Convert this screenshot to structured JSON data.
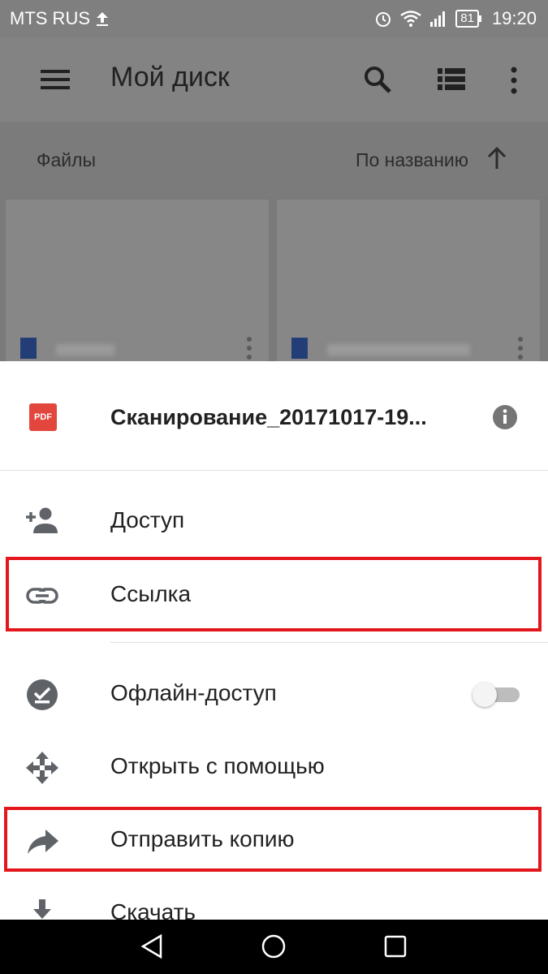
{
  "status_bar": {
    "carrier": "MTS RUS",
    "battery": "81",
    "time": "19:20"
  },
  "app_bar": {
    "title": "Мой диск",
    "icons": [
      "menu-icon",
      "search-icon",
      "list-view-icon",
      "more-vert-icon"
    ]
  },
  "sort_bar": {
    "section": "Файлы",
    "sort_label": "По названию"
  },
  "sheet": {
    "file_icon_label": "PDF",
    "file_name": "Сканирование_20171017-19...",
    "items": [
      {
        "label": "Доступ",
        "icon": "person-add-icon"
      },
      {
        "label": "Ссылка",
        "icon": "link-icon"
      },
      {
        "label": "Офлайн-доступ",
        "icon": "offline-check-icon",
        "toggle": false
      },
      {
        "label": "Открыть с помощью",
        "icon": "open-with-icon"
      },
      {
        "label": "Отправить копию",
        "icon": "share-arrow-icon"
      },
      {
        "label": "Скачать",
        "icon": "download-icon"
      }
    ]
  },
  "colors": {
    "highlight": "#e4161d",
    "pdf": "#e2463d",
    "icon_gray": "#5f6368"
  }
}
